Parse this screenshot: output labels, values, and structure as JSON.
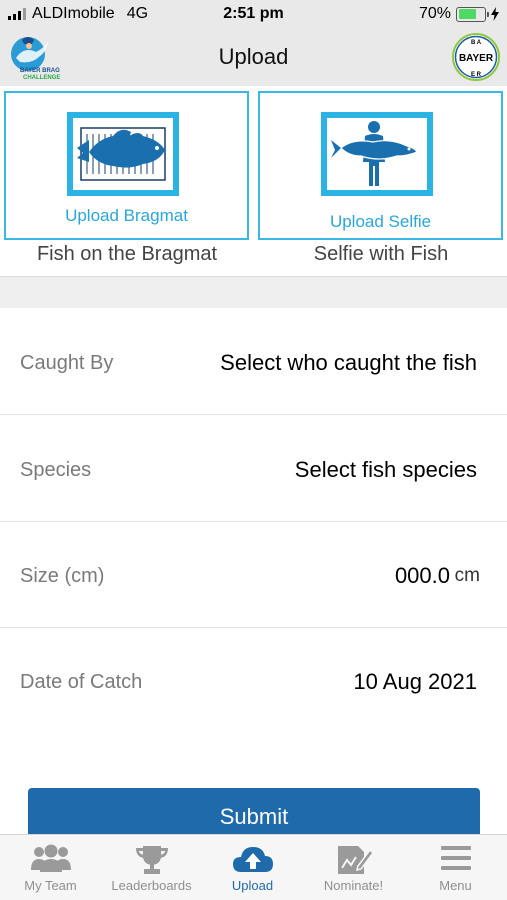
{
  "status_bar": {
    "carrier": "ALDImobile",
    "network": "4G",
    "time": "2:51 pm",
    "battery_percent": "70%",
    "battery_level": 0.7
  },
  "header": {
    "title": "Upload",
    "left_logo_icon": "bream-challenge-logo",
    "right_logo_icon": "bayer-logo",
    "right_logo_text": "BAYER"
  },
  "upload": {
    "bragmat": {
      "button_label": "Upload Bragmat",
      "caption": "Fish on the Bragmat",
      "icon": "fish-on-mat-icon"
    },
    "selfie": {
      "button_label": "Upload Selfie",
      "caption": "Selfie with Fish",
      "icon": "person-holding-fish-icon"
    }
  },
  "form": {
    "caught_by": {
      "label": "Caught By",
      "value": "Select who caught the fish"
    },
    "species": {
      "label": "Species",
      "value": "Select fish species"
    },
    "size": {
      "label": "Size (cm)",
      "value": "000.0",
      "unit": "cm"
    },
    "date": {
      "label": "Date of Catch",
      "value": "10 Aug 2021"
    }
  },
  "submit_label": "Submit",
  "tabs": [
    {
      "label": "My Team",
      "icon": "team-icon",
      "active": false
    },
    {
      "label": "Leaderboards",
      "icon": "trophy-icon",
      "active": false
    },
    {
      "label": "Upload",
      "icon": "cloud-upload-icon",
      "active": true
    },
    {
      "label": "Nominate!",
      "icon": "nominate-icon",
      "active": false
    },
    {
      "label": "Menu",
      "icon": "hamburger-menu-icon",
      "active": false
    }
  ],
  "colors": {
    "accent": "#1e6aab",
    "card_border": "#3ab7e3",
    "fish_blue": "#1a6fae",
    "battery": "#4cd964"
  }
}
